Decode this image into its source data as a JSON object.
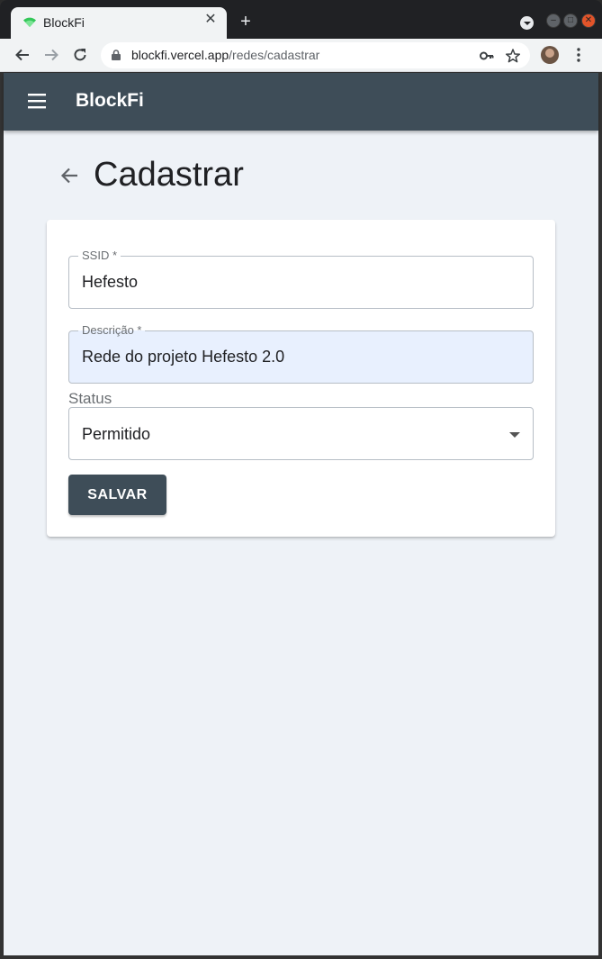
{
  "browser": {
    "tab_title": "BlockFi",
    "new_tab_symbol": "+",
    "url_host": "blockfi.vercel.app",
    "url_path": "/redes/cadastrar"
  },
  "app": {
    "title": "BlockFi",
    "accent_color": "#3e4d58",
    "background_color": "#eef2f7"
  },
  "page": {
    "title": "Cadastrar"
  },
  "form": {
    "ssid": {
      "label": "SSID *",
      "value": "Hefesto"
    },
    "descricao": {
      "label": "Descrição *",
      "value": "Rede do projeto Hefesto 2.0"
    },
    "status": {
      "label": "Status",
      "value": "Permitido"
    },
    "save_label": "SALVAR"
  }
}
